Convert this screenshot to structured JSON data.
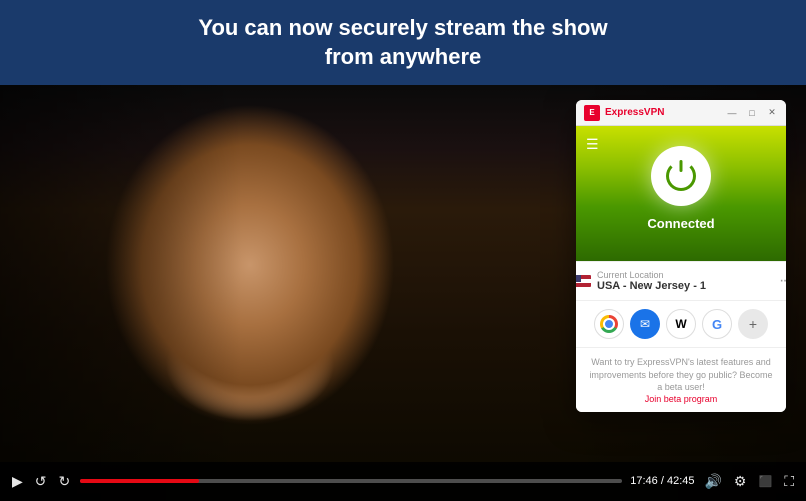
{
  "header": {
    "text_line1": "You can now securely stream the show",
    "text_line2": "from anywhere",
    "bg_color": "#1a3a6b"
  },
  "video": {
    "controls": {
      "play_btn": "▶",
      "back_btn": "↺",
      "forward_btn": "↻",
      "time_current": "17:46",
      "time_total": "42:45",
      "volume_icon": "🔊",
      "fullscreen_icon": "⛶",
      "settings_icon": "⚙",
      "cast_icon": "⬛"
    },
    "progress_percent": 22
  },
  "vpn_window": {
    "title": "ExpressVPN",
    "window_controls": {
      "minimize": "—",
      "maximize": "□",
      "close": "✕"
    },
    "status": "Connected",
    "location": {
      "label": "Current Location",
      "name": "USA - New Jersey - 1"
    },
    "shortcuts": [
      {
        "name": "Chrome",
        "symbol": "◎"
      },
      {
        "name": "Mail",
        "symbol": "✉"
      },
      {
        "name": "Wikipedia",
        "symbol": "W"
      },
      {
        "name": "Google",
        "symbol": "G"
      },
      {
        "name": "Plus",
        "symbol": "+"
      }
    ],
    "footer_text": "Want to try ExpressVPN's latest features and improvements before they go public? Become a beta user!",
    "footer_link": "Join beta program"
  }
}
